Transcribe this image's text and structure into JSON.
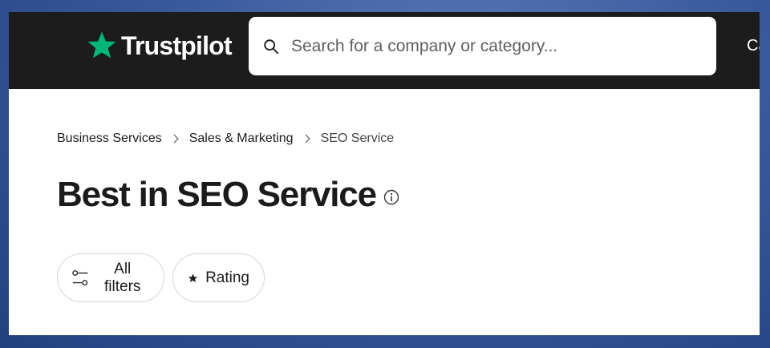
{
  "header": {
    "logo_text": "Trustpilot",
    "search": {
      "placeholder": "Search for a company or category..."
    },
    "nav_truncated_label": "Ca"
  },
  "breadcrumb": [
    {
      "label": "Business Services"
    },
    {
      "label": "Sales & Marketing"
    },
    {
      "label": "SEO Service"
    }
  ],
  "page": {
    "title": "Best in SEO Service"
  },
  "filters": {
    "all_filters_label": "All filters",
    "rating_label": "Rating"
  },
  "icons": {
    "logo": "star-icon",
    "search": "search-icon",
    "breadcrumb_separator": "chevron-right-icon",
    "info": "info-icon",
    "filters": "sliders-icon",
    "rating": "star-icon"
  },
  "colors": {
    "header_bg": "#1c1c1c",
    "brand_green": "#00b67a",
    "text": "#1b1b1b",
    "pill_border": "#d6d6d6"
  }
}
